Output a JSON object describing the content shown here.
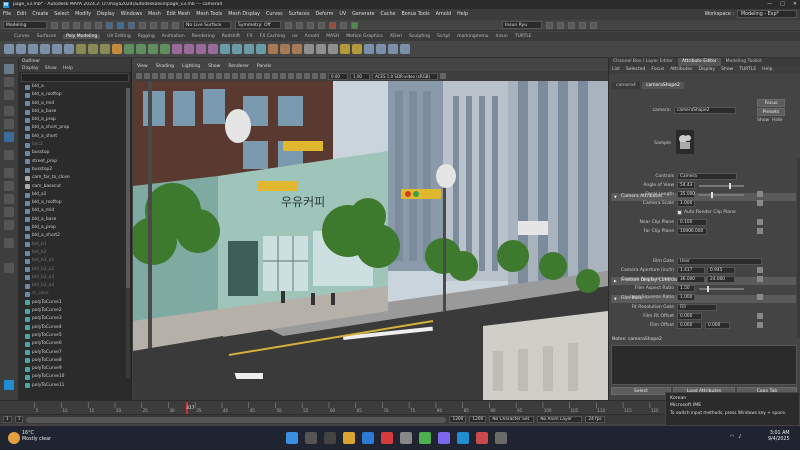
{
  "window": {
    "title": "page_v3.mb* - Autodesk MAYA 2024.2: D:\\maya2024\\autodeskalvin\\page_v3.mb --- camera4",
    "controls": [
      "—",
      "□",
      "✕"
    ]
  },
  "menubar": {
    "items": [
      "File",
      "Edit",
      "Create",
      "Select",
      "Modify",
      "Display",
      "Windows",
      "Mesh",
      "Edit Mesh",
      "Mesh Tools",
      "Mesh Display",
      "Curves",
      "Surfaces",
      "Deform",
      "UV",
      "Generate",
      "Cache",
      "Bonus Tools",
      "Arnold",
      "Help"
    ],
    "workspace_label": "Workspace :",
    "workspace_value": "Modeling - Exp*"
  },
  "statusline": {
    "mode": "Modeling",
    "live_surface": "No Live Surface",
    "symmetry": "Symmetry: Off",
    "user": "Insun Ryu"
  },
  "shelf": {
    "tabs": [
      "Curves",
      "Surfaces",
      "Poly Modeling",
      "UV Editing",
      "Rigging",
      "Animation",
      "Rendering",
      "Redshift",
      "FX",
      "FX Caching",
      "ux",
      "Arnold",
      "MASH",
      "Motion Graphics",
      "XGen",
      "Sculpting",
      "Script",
      "markingmenu",
      "Insun",
      "TURTLE"
    ],
    "active_tab": "Poly Modeling"
  },
  "outliner": {
    "title": "Outliner",
    "menu": [
      "Display",
      "Show",
      "Help"
    ],
    "items": [
      {
        "name": "bld_a",
        "dim": false,
        "type": "mesh"
      },
      {
        "name": "bld_a_rooftop",
        "dim": false,
        "type": "mesh"
      },
      {
        "name": "bld_a_mid",
        "dim": false,
        "type": "mesh"
      },
      {
        "name": "bld_a_base",
        "dim": false,
        "type": "mesh"
      },
      {
        "name": "bld_a_prop",
        "dim": false,
        "type": "mesh"
      },
      {
        "name": "bld_a_short_prop",
        "dim": false,
        "type": "mesh"
      },
      {
        "name": "bld_a_short",
        "dim": false,
        "type": "mesh"
      },
      {
        "name": "bac3",
        "dim": true,
        "type": "mesh"
      },
      {
        "name": "busstop",
        "dim": false,
        "type": "mesh"
      },
      {
        "name": "street_prop",
        "dim": false,
        "type": "mesh"
      },
      {
        "name": "busstop2",
        "dim": false,
        "type": "mesh"
      },
      {
        "name": "cam_far_to_close",
        "dim": false,
        "type": "cam"
      },
      {
        "name": "cam_basecut",
        "dim": false,
        "type": "cam"
      },
      {
        "name": "bld_a1",
        "dim": false,
        "type": "mesh"
      },
      {
        "name": "bld_a_rooftop",
        "dim": false,
        "type": "mesh"
      },
      {
        "name": "bld_a_mid",
        "dim": false,
        "type": "mesh"
      },
      {
        "name": "bld_a_base",
        "dim": false,
        "type": "mesh"
      },
      {
        "name": "bld_a_prop",
        "dim": false,
        "type": "mesh"
      },
      {
        "name": "bld_a_short2",
        "dim": false,
        "type": "mesh"
      },
      {
        "name": "bld_b1",
        "dim": true,
        "type": "mesh"
      },
      {
        "name": "bld_b2",
        "dim": true,
        "type": "mesh"
      },
      {
        "name": "bld_b3_a1",
        "dim": true,
        "type": "mesh"
      },
      {
        "name": "bld_b3_a2",
        "dim": true,
        "type": "mesh"
      },
      {
        "name": "bld_b3_a3",
        "dim": true,
        "type": "mesh"
      },
      {
        "name": "bld_b3_a4",
        "dim": true,
        "type": "mesh"
      },
      {
        "name": "ct_cons",
        "dim": true,
        "type": "mesh"
      },
      {
        "name": "polyToCurve1",
        "dim": false,
        "type": "curve"
      },
      {
        "name": "polyToCurve2",
        "dim": false,
        "type": "curve"
      },
      {
        "name": "polyToCurve3",
        "dim": false,
        "type": "curve"
      },
      {
        "name": "polyToCurve4",
        "dim": false,
        "type": "curve"
      },
      {
        "name": "polyToCurve5",
        "dim": false,
        "type": "curve"
      },
      {
        "name": "polyToCurve6",
        "dim": false,
        "type": "curve"
      },
      {
        "name": "polyToCurve7",
        "dim": false,
        "type": "curve"
      },
      {
        "name": "polyToCurve8",
        "dim": false,
        "type": "curve"
      },
      {
        "name": "polyToCurve9",
        "dim": false,
        "type": "curve"
      },
      {
        "name": "polyToCurve10",
        "dim": false,
        "type": "curve"
      },
      {
        "name": "polyToCurve11",
        "dim": false,
        "type": "curve"
      }
    ]
  },
  "viewport": {
    "menu": [
      "View",
      "Shading",
      "Lighting",
      "Show",
      "Renderer",
      "Panels"
    ],
    "colorspace": "ACES 1.0 SDR-video (sRGB)",
    "exposure": "0.00",
    "gamma": "1.00",
    "sign_text": "우유커피"
  },
  "attribute_editor": {
    "tabs": [
      "Channel Box / Layer Editor",
      "Attribute Editor",
      "Modeling Toolkit"
    ],
    "active_tab": "Attribute Editor",
    "menu": [
      "List",
      "Selected",
      "Focus",
      "Attributes",
      "Display",
      "Show",
      "TURTLE",
      "Help"
    ],
    "node_tabs": [
      "camera4",
      "cameraShape2"
    ],
    "active_node_tab": "cameraShape2",
    "node_label": "camera:",
    "node_value": "cameraShape2",
    "buttons": {
      "focus": "Focus",
      "presets": "Presets",
      "show": "Show",
      "hide": "Hide"
    },
    "sample_label": "Sample",
    "camera_section": "Camera Attributes",
    "controls_label": "Controls",
    "controls_value": "Camera",
    "angle_of_view_label": "Angle of View",
    "angle_of_view": "54.43",
    "focal_length_label": "Focal Length",
    "focal_length": "35.000",
    "camera_scale_label": "Camera Scale",
    "camera_scale": "1.000",
    "auto_clip_label": "Auto Render Clip Plane",
    "near_clip_label": "Near Clip Plane",
    "near_clip": "0.100",
    "far_clip_label": "Far Clip Plane",
    "far_clip": "10000.000",
    "frustum_section": "Frustum Display Controls",
    "film_back_section": "Film Back",
    "film_gate_label": "Film Gate",
    "film_gate_value": "User",
    "aperture_inch_label": "Camera Aperture (inch)",
    "aperture_inch_a": "1.417",
    "aperture_inch_b": "0.945",
    "aperture_mm_label": "Camera Aperture (mm)",
    "aperture_mm_a": "36.000",
    "aperture_mm_b": "24.000",
    "film_aspect_label": "Film Aspect Ratio",
    "film_aspect": "1.50",
    "lens_squeeze_label": "Lens Squeeze Ratio",
    "lens_squeeze": "1.000",
    "fit_res_gate_label": "Fit Resolution Gate",
    "fit_res_gate_value": "Fill",
    "film_fit_offset_label": "Film Fit Offset",
    "film_fit_offset": "0.000",
    "film_offset_label": "Film Offset",
    "film_offset_a": "0.000",
    "film_offset_b": "0.000",
    "notes_label": "Notes:  cameraShape2",
    "bottom_buttons": [
      "Select",
      "Load Attributes",
      "Copy Tab"
    ]
  },
  "timeline": {
    "ticks": [
      "5",
      "10",
      "15",
      "20",
      "25",
      "30",
      "35",
      "40",
      "45",
      "50",
      "55",
      "60",
      "65",
      "70",
      "75",
      "80",
      "85",
      "90",
      "95",
      "100",
      "105",
      "110",
      "115",
      "120",
      "125"
    ],
    "current_frame": "317",
    "range_start": "1",
    "range_inner_start": "1",
    "range_inner_end": "1200",
    "range_end": "1200",
    "character_set": "No Character Set",
    "anim_layer": "No Anim Layer",
    "fps": "24 fps"
  },
  "ime_popup": {
    "line1": "Korean",
    "line2": "Microsoft IME",
    "line3": "To switch input methods, press Windows key + space."
  },
  "taskbar": {
    "weather_temp": "16°C",
    "weather_desc": "Mostly clear",
    "time": "3:01 AM",
    "date": "9/4/2025"
  }
}
